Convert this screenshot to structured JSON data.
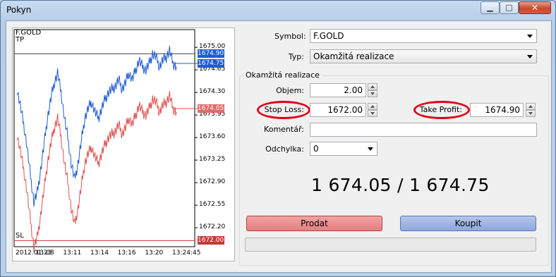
{
  "window": {
    "title": "Pokyn",
    "min_glyph": "▁",
    "max_glyph": "□",
    "close_glyph": "✕"
  },
  "form": {
    "symbol_label": "Symbol:",
    "symbol_value": "F.GOLD",
    "type_label": "Typ:",
    "type_value": "Okamžitá realizace",
    "group_title": "Okamžitá realizace",
    "volume_label": "Objem:",
    "volume_value": "2.00",
    "stoploss_label": "Stop Loss:",
    "stoploss_value": "1672.00",
    "takeprofit_label": "Take Profit:",
    "takeprofit_value": "1674.90",
    "comment_label": "Komentář:",
    "comment_value": "",
    "deviation_label": "Odchylka:",
    "deviation_value": "0",
    "prices": "1 674.05 / 1 674.75",
    "sell_label": "Prodat",
    "buy_label": "Koupit"
  },
  "colors": {
    "bid": "#e05050",
    "ask": "#1f5bd6",
    "tp_tag": "#1f5bd6",
    "sl_tag": "#c43a3a",
    "bid_tag": "#e06a6a",
    "tp_line": "#404040"
  },
  "chart_data": {
    "type": "line",
    "symbol_label": "F.GOLD",
    "tp_label": "TP",
    "sl_label": "SL",
    "y_ticks": [
      "1675.00",
      "1674.65",
      "1674.30",
      "1673.95",
      "1673.60",
      "1673.25",
      "1672.90",
      "1672.55",
      "1672.20"
    ],
    "y_tick_values": [
      1675.0,
      1674.65,
      1674.3,
      1673.95,
      1673.6,
      1673.25,
      1672.9,
      1672.55,
      1672.2
    ],
    "x_ticks": [
      "2012.01.23",
      "13:08",
      "13:11",
      "13:14",
      "13:16",
      "13:20",
      "13:24:45"
    ],
    "ylim": [
      1671.95,
      1675.1
    ],
    "levels": {
      "take_profit": 1674.9,
      "stop_loss": 1672.0,
      "ask": 1674.75,
      "bid": 1674.05
    },
    "tag_texts": {
      "take_profit": "1674.90",
      "ask": "1674.75",
      "bid": "1674.05",
      "stop_loss": "1672.00"
    },
    "series": [
      {
        "values": [
          1674.35,
          1674.1,
          1673.8,
          1673.45,
          1673.0,
          1672.6,
          1672.75,
          1673.1,
          1673.5,
          1673.9,
          1674.2,
          1674.45,
          1674.6,
          1674.3,
          1673.9,
          1673.6,
          1673.2,
          1672.95,
          1673.2,
          1673.55,
          1673.9,
          1674.05,
          1674.15,
          1674.0,
          1673.9,
          1674.05,
          1674.2,
          1674.3,
          1674.35,
          1674.4,
          1674.5,
          1674.35,
          1674.45,
          1674.6,
          1674.5,
          1674.65,
          1674.8,
          1674.7,
          1674.65,
          1674.75,
          1674.9,
          1674.85,
          1674.7,
          1674.8,
          1674.85,
          1674.95,
          1674.75,
          1674.7
        ]
      },
      {
        "values": [
          1673.65,
          1673.4,
          1673.1,
          1672.75,
          1672.3,
          1671.9,
          1672.05,
          1672.4,
          1672.8,
          1673.2,
          1673.5,
          1673.75,
          1673.9,
          1673.6,
          1673.2,
          1672.9,
          1672.5,
          1672.25,
          1672.5,
          1672.85,
          1673.2,
          1673.35,
          1673.45,
          1673.3,
          1673.2,
          1673.35,
          1673.5,
          1673.6,
          1673.65,
          1673.7,
          1673.8,
          1673.65,
          1673.75,
          1673.9,
          1673.8,
          1673.95,
          1674.1,
          1674.0,
          1673.95,
          1674.05,
          1674.2,
          1674.15,
          1674.0,
          1674.1,
          1674.15,
          1674.25,
          1674.05,
          1674.0
        ]
      }
    ],
    "grid": false
  }
}
